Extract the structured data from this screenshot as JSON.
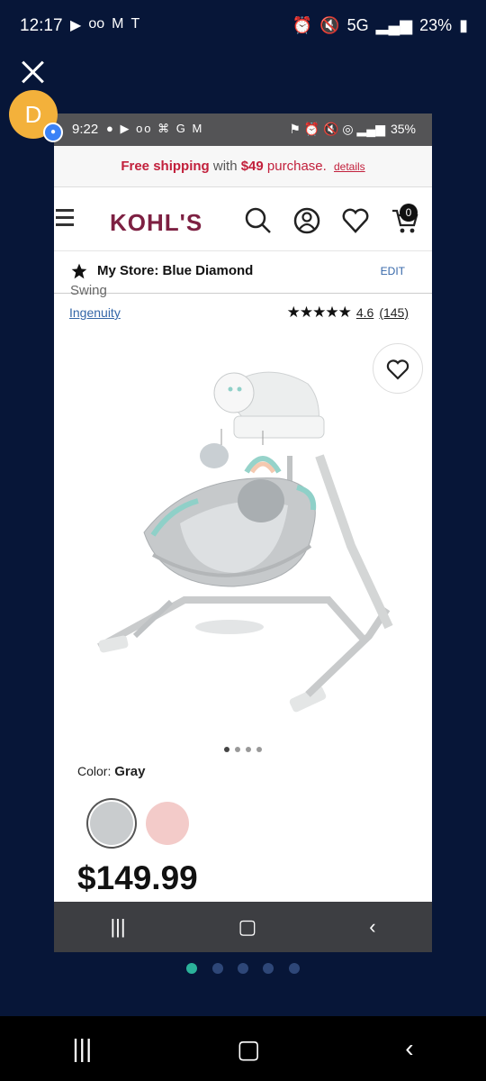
{
  "outer_status": {
    "time": "12:17",
    "left_icons": "▶ ᴏᴏ M T",
    "network": "5G",
    "battery": "23%"
  },
  "inner_status": {
    "time": "9:22",
    "left_icons": "● ▶ ᴏᴏ ⌘ G M",
    "battery": "35%"
  },
  "promo": {
    "prefix": "Free shipping",
    "middle": "with",
    "amount": "$49",
    "suffix": "purchase.",
    "link": "details"
  },
  "header": {
    "logo": "KOHL'S",
    "avatar_letter": "D",
    "cart_count": "0"
  },
  "store": {
    "label": "My Store: Blue Diamond",
    "edit": "EDIT"
  },
  "product": {
    "cut_title": "Swing",
    "brand": "Ingenuity",
    "rating": "4.6",
    "reviews": "(145)",
    "stars_value": 4.6,
    "color_label": "Color:",
    "color_value": "Gray",
    "price": "$149.99",
    "image_count": 4,
    "active_image": 1
  },
  "pager": {
    "count": 5,
    "active": 1
  },
  "colors": {
    "accent": "#c2203c",
    "kohls": "#7d2042",
    "link": "#3466a8",
    "background": "#071638"
  }
}
